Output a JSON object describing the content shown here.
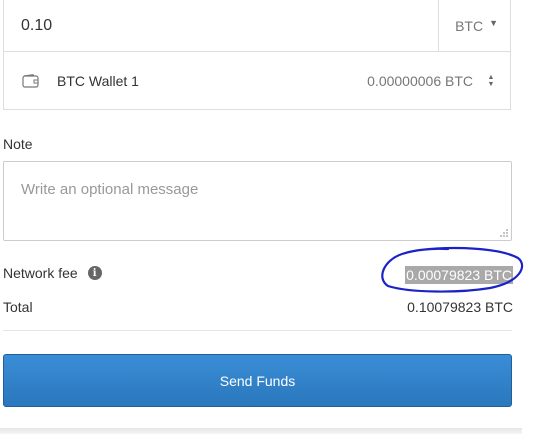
{
  "amount": {
    "value": "0.10",
    "currency": "BTC"
  },
  "wallet": {
    "name": "BTC Wallet 1",
    "balance": "0.00000006 BTC"
  },
  "note": {
    "label": "Note",
    "placeholder": "Write an optional message"
  },
  "fee": {
    "label": "Network fee",
    "value": "0.00079823 BTC",
    "info_icon": "info-icon"
  },
  "total": {
    "label": "Total",
    "value": "0.10079823 BTC"
  },
  "send_button": {
    "label": "Send Funds"
  },
  "colors": {
    "button": "#2a77bd",
    "annotation": "#1a22c8",
    "highlight": "#a9a9a9"
  }
}
